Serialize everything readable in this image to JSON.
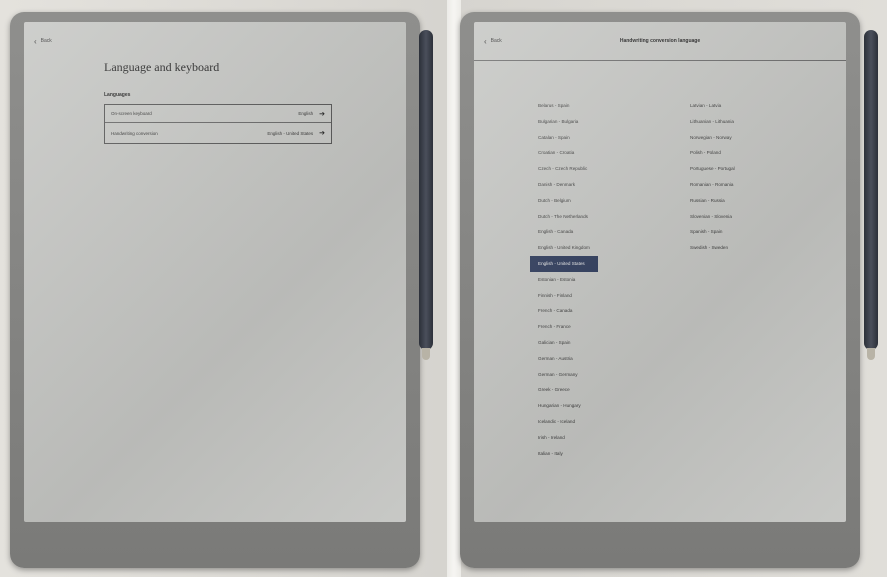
{
  "left_screen": {
    "back_label": "Back",
    "title": "Language and keyboard",
    "section_label": "Languages",
    "rows": [
      {
        "label": "On-screen keyboard",
        "value": "English"
      },
      {
        "label": "Handwriting conversion",
        "value": "English - United States"
      }
    ]
  },
  "right_screen": {
    "back_label": "Back",
    "title": "Handwriting conversion language",
    "selected_index": 10,
    "column1": [
      "Belarus - Spain",
      "Bulgarian - Bulgaria",
      "Catalan - Spain",
      "Croatian - Croatia",
      "Czech - Czech Republic",
      "Danish - Denmark",
      "Dutch - Belgium",
      "Dutch - The Netherlands",
      "English - Canada",
      "English - United Kingdom",
      "English - United States",
      "Estonian - Estonia",
      "Finnish - Finland",
      "French - Canada",
      "French - France",
      "Galician - Spain",
      "German - Austria",
      "German - Germany",
      "Greek - Greece",
      "Hungarian - Hungary",
      "Icelandic - Iceland",
      "Irish - Ireland",
      "Italian - Italy"
    ],
    "column2": [
      "Latvian - Latvia",
      "Lithuanian - Lithuania",
      "Norwegian - Norway",
      "Polish - Poland",
      "Portuguese - Portugal",
      "Romanian - Romania",
      "Russian - Russia",
      "Slovenian - Slovenia",
      "Spanish - Spain",
      "Swedish - Sweden"
    ]
  },
  "colors": {
    "screen": "#c3c4c1",
    "selected_bg": "#2d3a5a",
    "device": "#858583"
  },
  "icons": [
    "chevron-left-icon",
    "arrow-right-icon"
  ]
}
